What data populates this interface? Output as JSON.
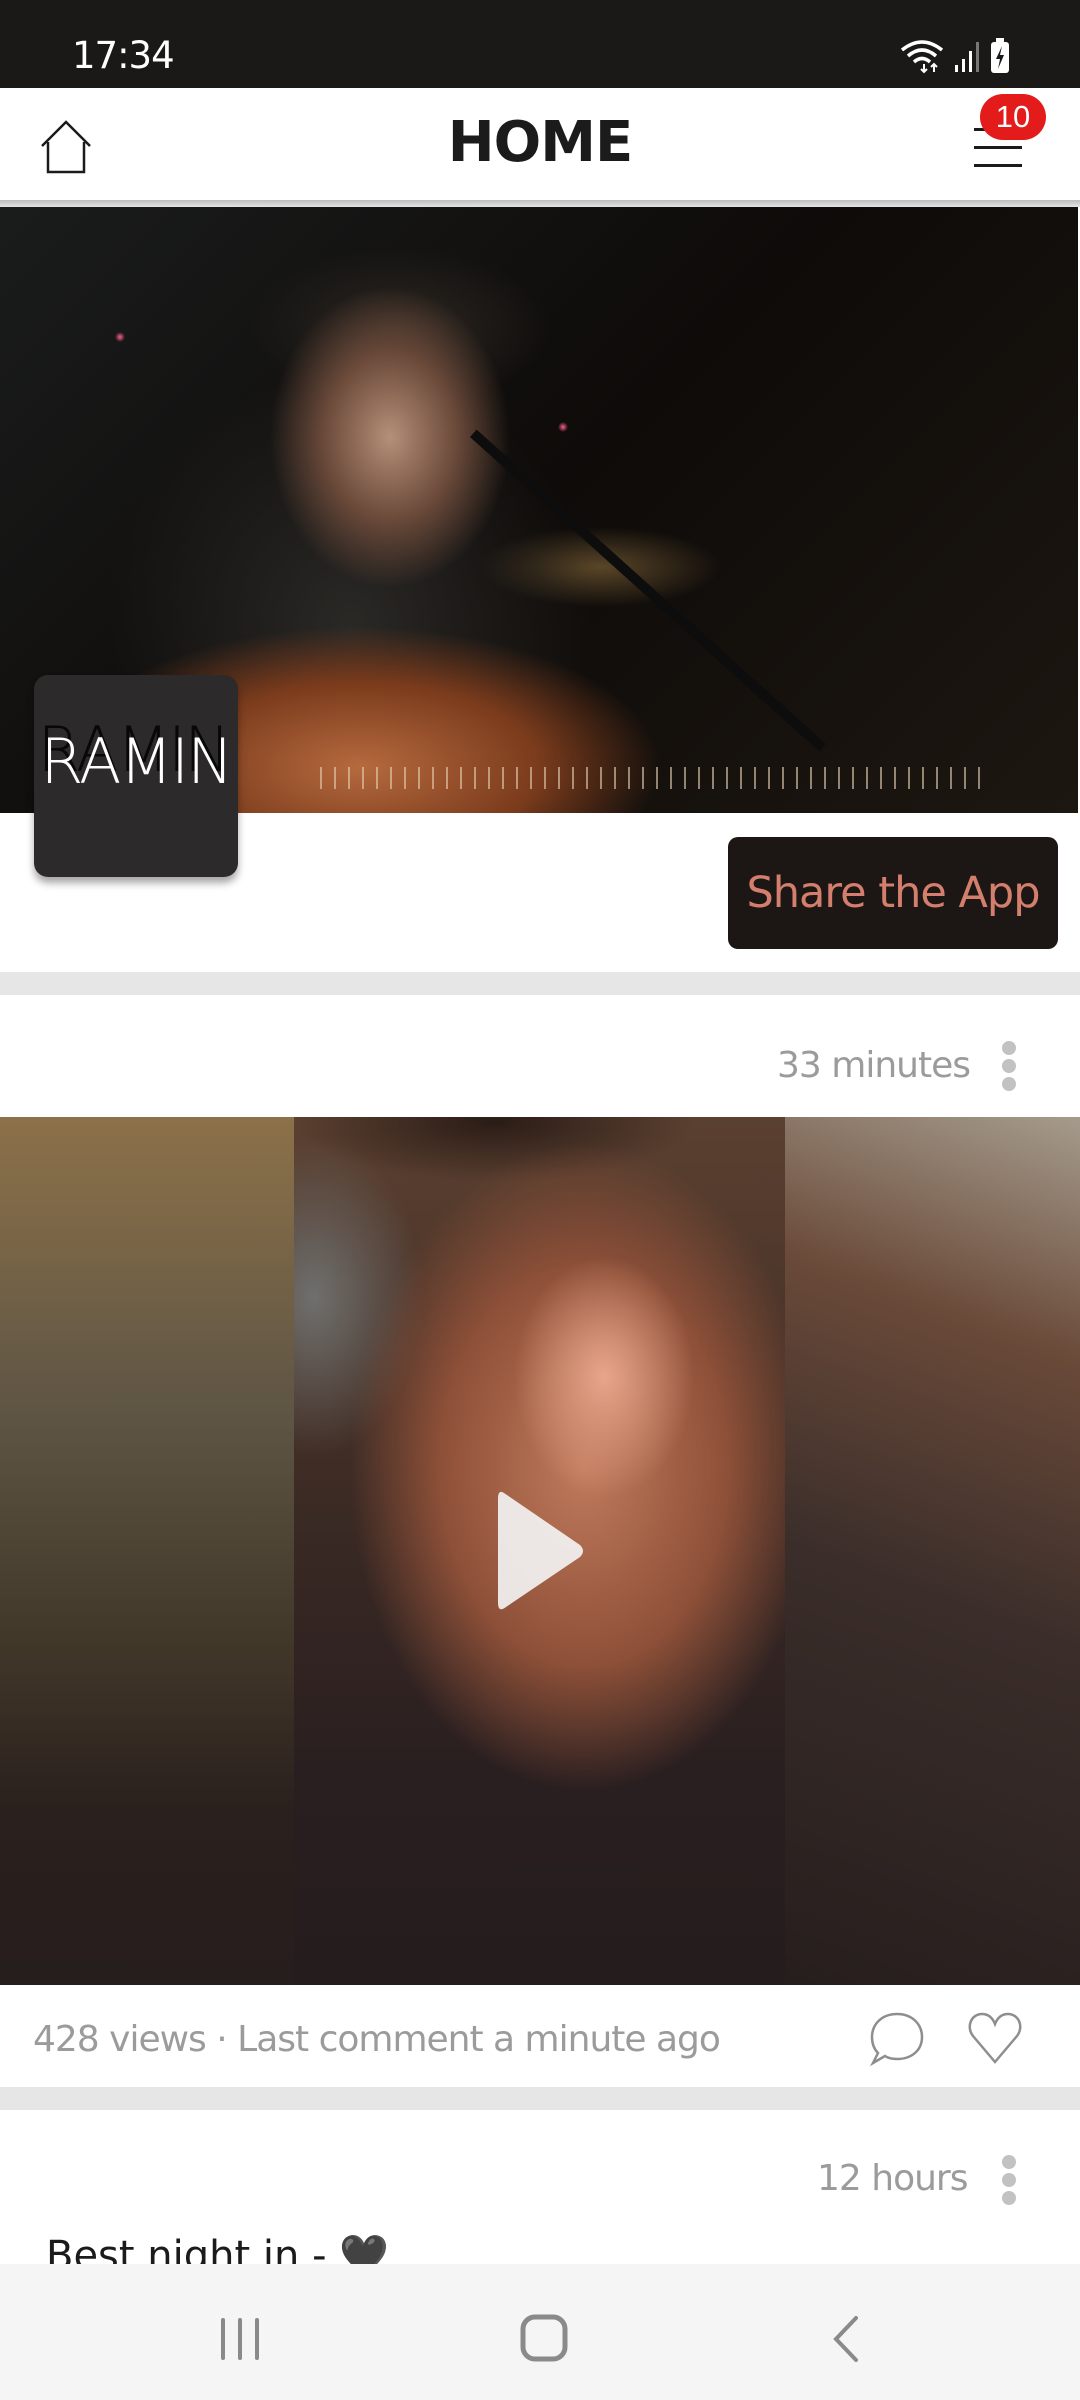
{
  "status_bar": {
    "time": "17:34",
    "icons": [
      "wifi-icon",
      "signal-icon",
      "battery-charging-icon"
    ]
  },
  "header": {
    "title": "HOME",
    "home_icon": "home-icon",
    "menu_icon": "hamburger-menu-icon",
    "notification_count": "10",
    "badge_color": "#e31b1b"
  },
  "profile": {
    "logo_text": "RAMIN",
    "share_button_label": "Share the App",
    "share_button_text_color": "#d47e6d"
  },
  "posts": [
    {
      "time": "33 minutes",
      "media_type": "video",
      "views_text": "428 views · Last comment a minute ago",
      "actions": [
        "comment-icon",
        "like-heart-icon"
      ]
    },
    {
      "time": "12 hours",
      "caption": "Best night in - 🖤"
    }
  ],
  "nav_bar": {
    "buttons": [
      "recent-apps",
      "home",
      "back"
    ]
  }
}
